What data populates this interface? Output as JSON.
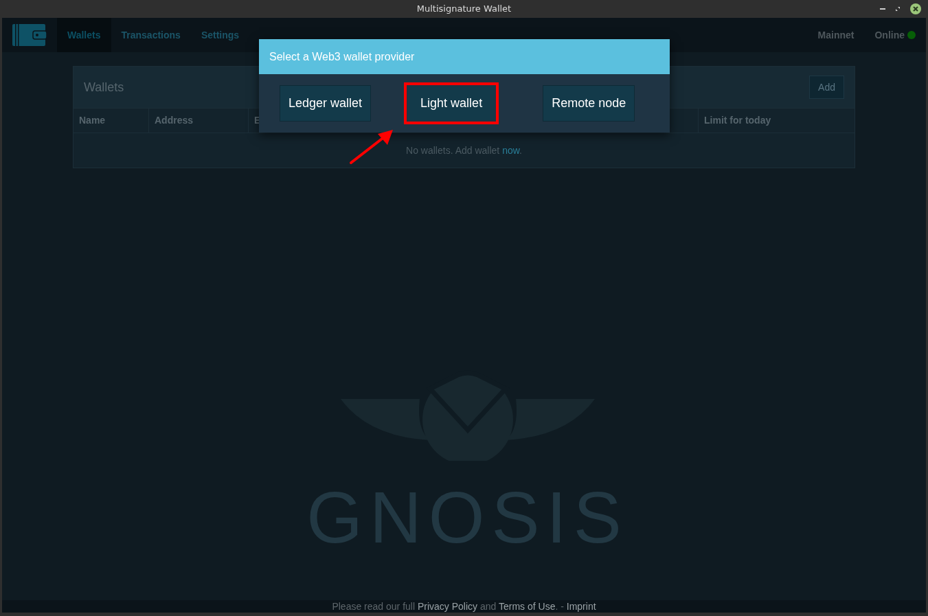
{
  "window": {
    "title": "Multisignature Wallet"
  },
  "nav": {
    "tabs": [
      {
        "label": "Wallets",
        "selected": true
      },
      {
        "label": "Transactions",
        "selected": false
      },
      {
        "label": "Settings",
        "selected": false
      }
    ],
    "network": "Mainnet",
    "status": {
      "label": "Online",
      "color": "#075e07"
    }
  },
  "panel": {
    "title": "Wallets",
    "add_button": "Add",
    "columns": [
      "Name",
      "Address",
      "E",
      "Limit for today"
    ],
    "empty_message": [
      {
        "kind": "text",
        "text": "No wallets. Add wallet "
      },
      {
        "kind": "link",
        "text": "now"
      },
      {
        "kind": "text",
        "text": "."
      }
    ]
  },
  "modal": {
    "title": "Select a Web3 wallet provider",
    "buttons": [
      {
        "label": "Ledger wallet",
        "highlighted": false
      },
      {
        "label": "Light wallet",
        "highlighted": true
      },
      {
        "label": "Remote node",
        "highlighted": false
      }
    ]
  },
  "background_logo": {
    "text": "GNOSIS"
  },
  "footer": [
    {
      "kind": "text",
      "text": "Please read our full "
    },
    {
      "kind": "link",
      "text": "Privacy Policy"
    },
    {
      "kind": "text",
      "text": " and "
    },
    {
      "kind": "link",
      "text": "Terms of Use"
    },
    {
      "kind": "text",
      "text": ". - "
    },
    {
      "kind": "link",
      "text": "Imprint"
    }
  ]
}
